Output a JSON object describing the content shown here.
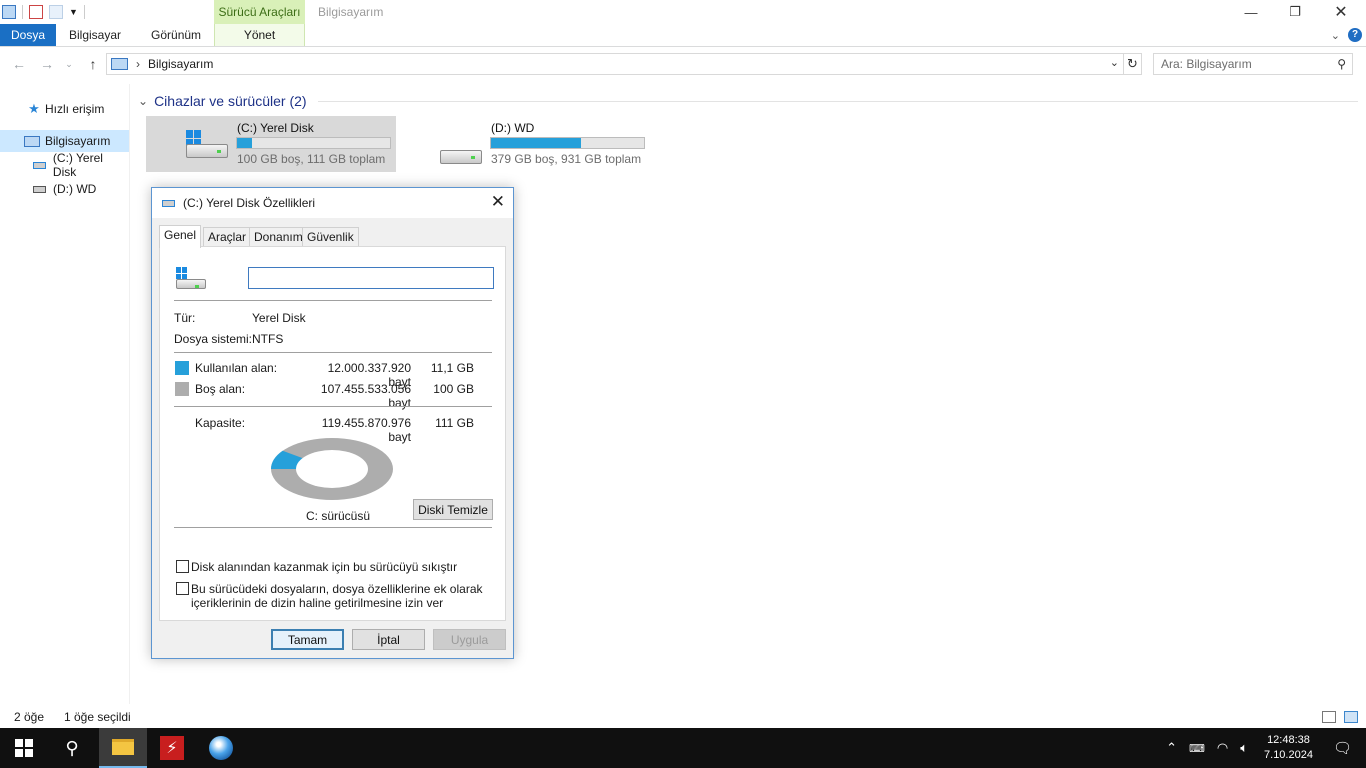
{
  "window": {
    "title": "Bilgisayarım",
    "context_tab": "Sürücü Araçları",
    "context_subtab": "Yönet",
    "ribbon_tabs": [
      "Dosya",
      "Bilgisayar",
      "Görünüm"
    ]
  },
  "address": {
    "path": "Bilgisayarım",
    "search_placeholder": "Ara: Bilgisayarım"
  },
  "nav": {
    "quick_access": "Hızlı erişim",
    "this_pc": "Bilgisayarım",
    "drive_c": "(C:) Yerel Disk",
    "drive_d": "(D:) WD"
  },
  "content": {
    "section_title": "Cihazlar ve sürücüler (2)",
    "drives": [
      {
        "name": "(C:) Yerel Disk",
        "free_text": "100 GB boş, 111 GB toplam",
        "used_fraction": 0.1
      },
      {
        "name": "(D:) WD",
        "free_text": "379 GB boş, 931 GB toplam",
        "used_fraction": 0.59
      }
    ]
  },
  "dialog": {
    "title": "(C:) Yerel Disk Özellikleri",
    "tabs": [
      "Genel",
      "Araçlar",
      "Donanım",
      "Güvenlik"
    ],
    "name_value": "",
    "type_label": "Tür:",
    "type_value": "Yerel Disk",
    "fs_label": "Dosya sistemi:",
    "fs_value": "NTFS",
    "used_label": "Kullanılan alan:",
    "used_bytes": "12.000.337.920 bayt",
    "used_gb": "11,1 GB",
    "free_label": "Boş alan:",
    "free_bytes": "107.455.533.056 bayt",
    "free_gb": "100 GB",
    "capacity_label": "Kapasite:",
    "capacity_bytes": "119.455.870.976 bayt",
    "capacity_gb": "111 GB",
    "used_fraction": 0.1,
    "drive_caption": "C: sürücüsü",
    "cleanup_button": "Diski Temizle",
    "compress_label": "Disk alanından kazanmak için bu sürücüyü sıkıştır",
    "index_label_line1": "Bu sürücüdeki dosyaların, dosya özelliklerine ek olarak",
    "index_label_line2": "içeriklerinin de dizin haline getirilmesine izin ver",
    "ok": "Tamam",
    "cancel": "İptal",
    "apply": "Uygula",
    "colors": {
      "used": "#26a0da",
      "free": "#adadad"
    }
  },
  "status": {
    "item_count": "2 öğe",
    "selected": "1 öğe seçildi"
  },
  "taskbar": {
    "time": "12:48:38",
    "date": "7.10.2024"
  }
}
